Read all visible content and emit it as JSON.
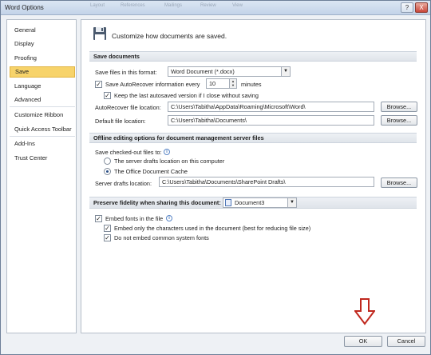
{
  "window": {
    "title": "Word Options",
    "ghost_tabs": [
      "Layout",
      "References",
      "Mailings",
      "Review",
      "View"
    ]
  },
  "titlebar": {
    "help_label": "?",
    "close_label": "X"
  },
  "sidebar": {
    "items": [
      {
        "label": "General"
      },
      {
        "label": "Display"
      },
      {
        "label": "Proofing"
      },
      {
        "label": "Save",
        "active": true
      },
      {
        "label": "Language"
      },
      {
        "label": "Advanced"
      },
      {
        "label": "Customize Ribbon"
      },
      {
        "label": "Quick Access Toolbar"
      },
      {
        "label": "Add-Ins"
      },
      {
        "label": "Trust Center"
      }
    ]
  },
  "header": {
    "text": "Customize how documents are saved."
  },
  "save_documents": {
    "section_title": "Save documents",
    "format_label": "Save files in this format:",
    "format_value": "Word Document (*.docx)",
    "autorecover_label": "Save AutoRecover information every",
    "autorecover_checked": true,
    "autorecover_minutes": "10",
    "minutes_label": "minutes",
    "keep_last_label": "Keep the last autosaved version if I close without saving",
    "keep_last_checked": true,
    "autorecover_location_label": "AutoRecover file location:",
    "autorecover_location_value": "C:\\Users\\Tabitha\\AppData\\Roaming\\Microsoft\\Word\\",
    "default_location_label": "Default file location:",
    "default_location_value": "C:\\Users\\Tabitha\\Documents\\",
    "browse_label": "Browse..."
  },
  "offline_editing": {
    "section_title": "Offline editing options for document management server files",
    "save_checked_out_label": "Save checked-out files to:",
    "option_server_label": "The server drafts location on this computer",
    "option_cache_label": "The Office Document Cache",
    "selected_option": "cache",
    "server_drafts_label": "Server drafts location:",
    "server_drafts_value": "C:\\Users\\Tabitha\\Documents\\SharePoint Drafts\\",
    "browse_label": "Browse..."
  },
  "fidelity": {
    "section_title": "Preserve fidelity when sharing this document:",
    "document_value": "Document3",
    "embed_fonts_label": "Embed fonts in the file",
    "embed_fonts_checked": true,
    "embed_only_label": "Embed only the characters used in the document (best for reducing file size)",
    "embed_only_checked": true,
    "do_not_embed_label": "Do not embed common system fonts",
    "do_not_embed_checked": true
  },
  "footer": {
    "ok_label": "OK",
    "cancel_label": "Cancel"
  },
  "colors": {
    "annotation_arrow": "#c0281e",
    "active_nav": "#f7d36a"
  }
}
